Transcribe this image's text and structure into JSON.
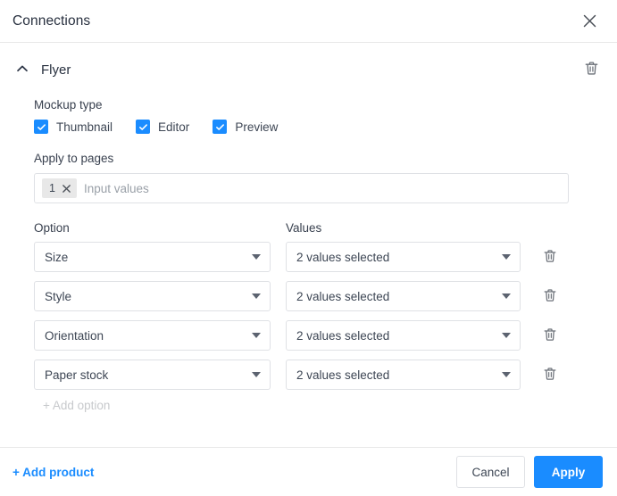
{
  "dialog": {
    "title": "Connections",
    "close_icon": "close-icon"
  },
  "product": {
    "name": "Flyer",
    "collapse_icon": "chevron-up-icon",
    "delete_icon": "trash-icon"
  },
  "mockup": {
    "label": "Mockup type",
    "options": [
      {
        "label": "Thumbnail",
        "checked": true
      },
      {
        "label": "Editor",
        "checked": true
      },
      {
        "label": "Preview",
        "checked": true
      }
    ]
  },
  "pages": {
    "label": "Apply to pages",
    "chips": [
      {
        "value": "1",
        "remove_icon": "close-icon"
      }
    ],
    "placeholder": "Input values"
  },
  "options_table": {
    "headers": {
      "option": "Option",
      "values": "Values"
    },
    "rows": [
      {
        "option": "Size",
        "values": "2 values selected",
        "delete_icon": "trash-icon"
      },
      {
        "option": "Style",
        "values": "2 values selected",
        "delete_icon": "trash-icon"
      },
      {
        "option": "Orientation",
        "values": "2 values selected",
        "delete_icon": "trash-icon"
      },
      {
        "option": "Paper stock",
        "values": "2 values selected",
        "delete_icon": "trash-icon"
      }
    ],
    "add_option_label": "+ Add option"
  },
  "footer": {
    "add_product_label": "+ Add product",
    "cancel_label": "Cancel",
    "apply_label": "Apply"
  },
  "colors": {
    "accent": "#1a8cff",
    "text": "#3d4654",
    "border": "#dfe1e5",
    "muted": "#c7c9cc",
    "chip_bg": "#e8e8e8"
  }
}
